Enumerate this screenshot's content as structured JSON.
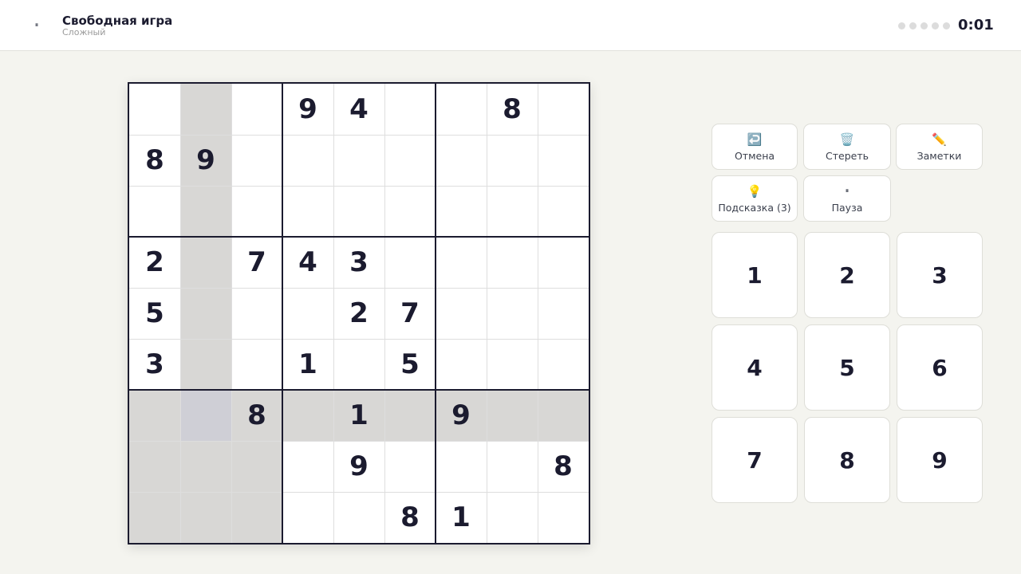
{
  "header": {
    "pause_icon": "⏸",
    "title": "Свободная игра",
    "difficulty": "Сложный",
    "mistakes_total": 5,
    "timer": "0:01"
  },
  "board": {
    "selected": [
      6,
      1
    ],
    "colors": {
      "cell": "#ffffff",
      "highlight": "#d8d7d5",
      "selected": "#cfcfd6",
      "digit": "#1b1b2f"
    },
    "grid": [
      [
        "",
        "",
        "",
        "9",
        "4",
        "",
        "",
        "8",
        ""
      ],
      [
        "8",
        "9",
        "",
        "",
        "",
        "",
        "",
        "",
        ""
      ],
      [
        "",
        "",
        "",
        "",
        "",
        "",
        "",
        "",
        ""
      ],
      [
        "2",
        "",
        "7",
        "4",
        "3",
        "",
        "",
        "",
        ""
      ],
      [
        "5",
        "",
        "",
        "",
        "2",
        "7",
        "",
        "",
        ""
      ],
      [
        "3",
        "",
        "",
        "1",
        "",
        "5",
        "",
        "",
        ""
      ],
      [
        "",
        "",
        "8",
        "",
        "1",
        "",
        "9",
        "",
        ""
      ],
      [
        "",
        "",
        "",
        "",
        "9",
        "",
        "",
        "",
        "8"
      ],
      [
        "",
        "",
        "",
        "",
        "",
        "8",
        "1",
        "",
        ""
      ]
    ]
  },
  "controls": {
    "undo": {
      "icon": "↩️",
      "label": "Отмена"
    },
    "erase": {
      "icon": "🗑️",
      "label": "Стереть"
    },
    "notes": {
      "icon": "✏️",
      "label": "Заметки"
    },
    "hint": {
      "icon": "💡",
      "label": "Подсказка (3)"
    },
    "pause": {
      "icon": "⏸",
      "label": "Пауза"
    }
  },
  "numpad": [
    "1",
    "2",
    "3",
    "4",
    "5",
    "6",
    "7",
    "8",
    "9"
  ]
}
